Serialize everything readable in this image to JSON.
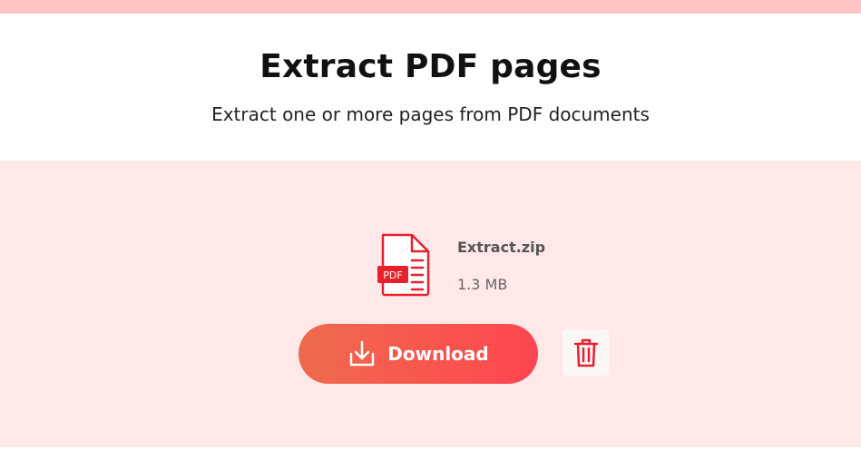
{
  "header": {
    "title": "Extract PDF pages",
    "subtitle": "Extract one or more pages from PDF documents"
  },
  "file": {
    "name": "Extract.zip",
    "size": "1.3 MB",
    "icon": "pdf-file-icon",
    "icon_badge": "PDF"
  },
  "actions": {
    "download_label": "Download",
    "download_icon": "download-icon",
    "delete_icon": "trash-icon"
  },
  "colors": {
    "top_strip": "#ffc4c4",
    "panel_background": "#ffe8e8",
    "accent_red": "#e8202c",
    "button_gradient_start": "#ee6b4d",
    "button_gradient_end": "#ff4550"
  }
}
